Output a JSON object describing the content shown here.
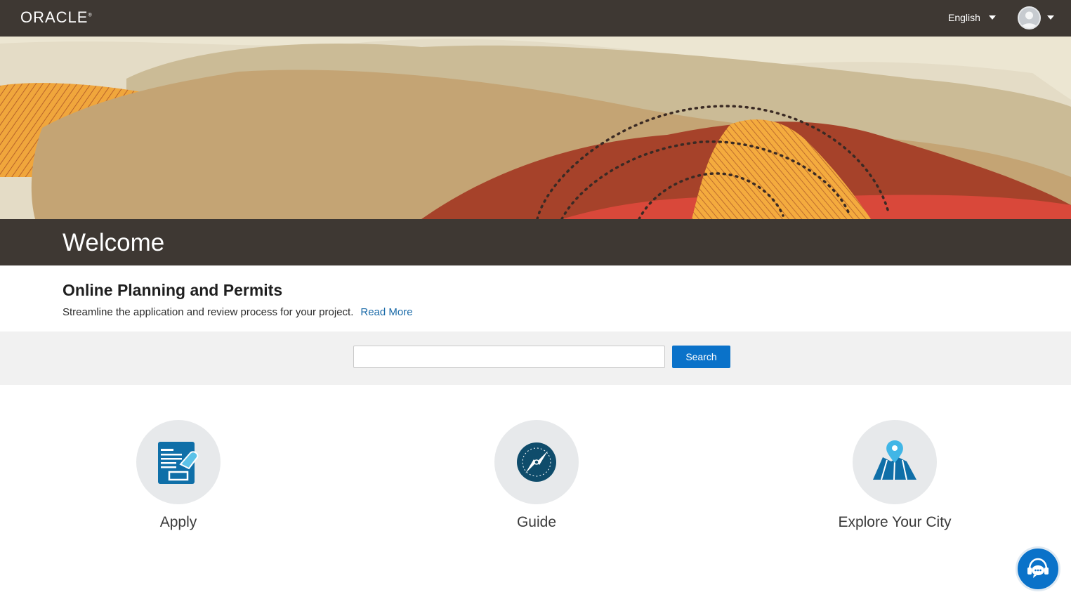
{
  "header": {
    "logo_text": "ORACLE",
    "language": "English"
  },
  "banner": {
    "welcome": "Welcome"
  },
  "intro": {
    "title": "Online Planning and Permits",
    "description": "Streamline the application and review process for your project.",
    "read_more": "Read More"
  },
  "search": {
    "value": "",
    "placeholder": "",
    "button_label": "Search"
  },
  "tiles": [
    {
      "label": "Apply",
      "icon": "apply-form-icon"
    },
    {
      "label": "Guide",
      "icon": "compass-icon"
    },
    {
      "label": "Explore Your City",
      "icon": "map-pin-icon"
    }
  ],
  "chat": {
    "icon": "chat-support-icon"
  },
  "colors": {
    "header_bg": "#3e3833",
    "accent": "#0a72c9",
    "link": "#1a6aa8",
    "icon_dark": "#0f4c6b"
  }
}
